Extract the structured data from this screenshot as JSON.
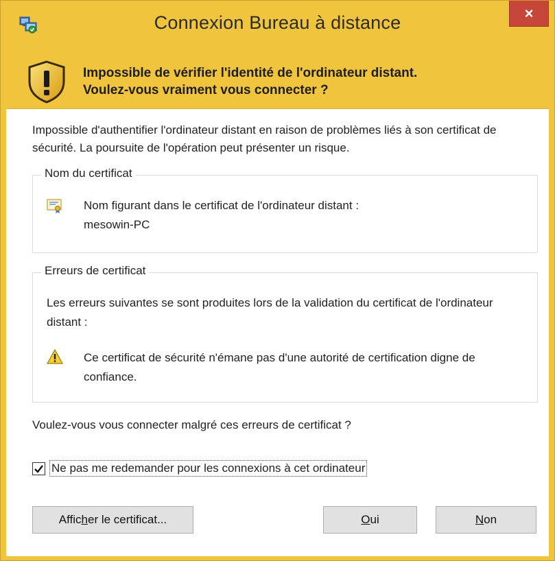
{
  "window": {
    "title": "Connexion Bureau à distance",
    "close_label": "×",
    "accent_color": "#f0c43c",
    "close_color": "#c7463a"
  },
  "banner": {
    "line1": "Impossible de vérifier l'identité de l'ordinateur distant.",
    "line2": "Voulez-vous vraiment vous connecter ?",
    "icon": "shield-warning-icon"
  },
  "intro_text": "Impossible d'authentifier l'ordinateur distant en raison de problèmes liés à son certificat de sécurité. La poursuite de l'opération peut présenter un risque.",
  "cert_group": {
    "legend": "Nom du certificat",
    "name_label": "Nom figurant dans le certificat de l'ordinateur distant :",
    "name_value": "mesowin-PC",
    "icon": "certificate-icon"
  },
  "errors_group": {
    "legend": "Erreurs de certificat",
    "intro": "Les erreurs suivantes se sont produites lors de la validation du certificat de l'ordinateur distant :",
    "error_text": "Ce certificat de sécurité n'émane pas d'une autorité de certification digne de confiance.",
    "icon": "warning-icon"
  },
  "question": "Voulez-vous vous connecter malgré ces erreurs de certificat ?",
  "dont_ask": {
    "label": "Ne pas me redemander pour les connexions à cet ordinateur",
    "checked": true
  },
  "buttons": {
    "view_cert_prefix": "Affic",
    "view_cert_mnemonic": "h",
    "view_cert_suffix": "er le certificat...",
    "yes_mnemonic": "O",
    "yes_rest": "ui",
    "no_mnemonic": "N",
    "no_rest": "on"
  }
}
